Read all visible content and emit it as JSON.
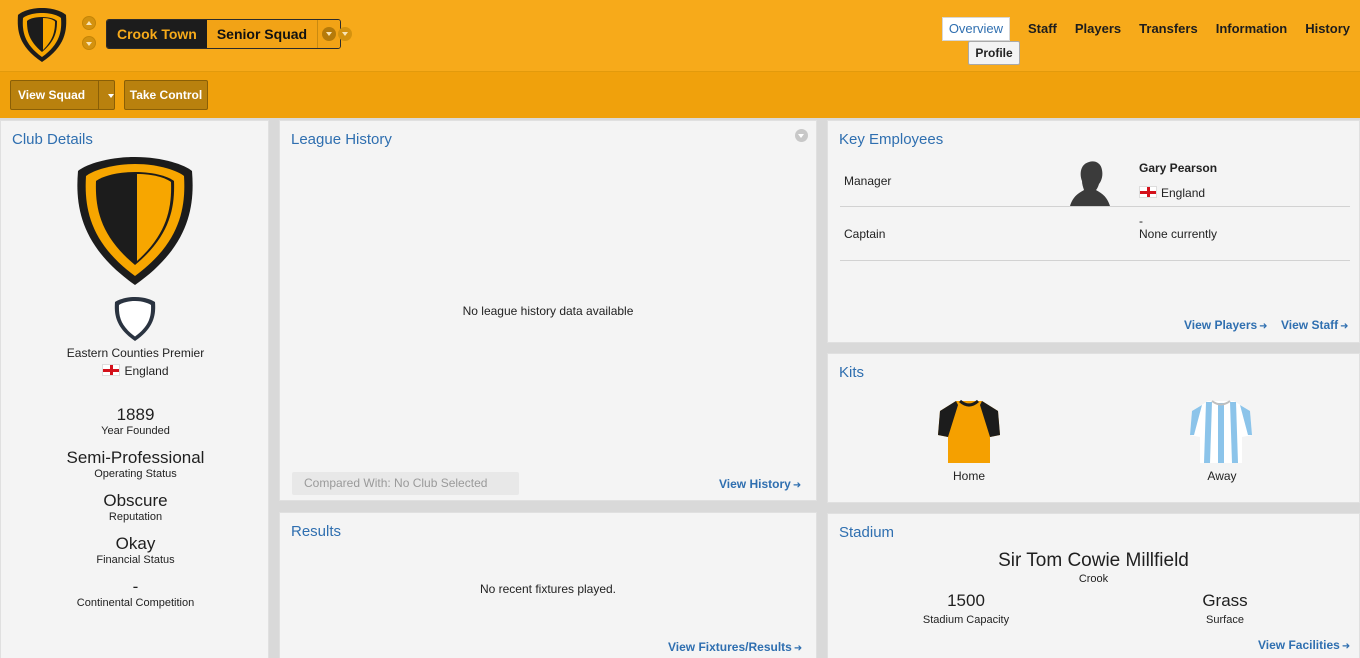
{
  "header": {
    "club_name": "Crook Town",
    "squad_name": "Senior Squad",
    "nav": [
      "Overview",
      "Staff",
      "Players",
      "Transfers",
      "Information",
      "History"
    ],
    "subnav": "Profile"
  },
  "toolbar": {
    "view_squad": "View Squad",
    "take_control": "Take Control"
  },
  "club_details": {
    "title": "Club Details",
    "competition": "Eastern Counties Premier",
    "nation": "England",
    "stats": [
      {
        "value": "1889",
        "label": "Year Founded"
      },
      {
        "value": "Semi-Professional",
        "label": "Operating Status"
      },
      {
        "value": "Obscure",
        "label": "Reputation"
      },
      {
        "value": "Okay",
        "label": "Financial Status"
      },
      {
        "value": "-",
        "label": "Continental Competition"
      }
    ]
  },
  "league_history": {
    "title": "League History",
    "empty_message": "No league history data available",
    "compare_label": "Compared With: No Club Selected",
    "link": "View History"
  },
  "results": {
    "title": "Results",
    "empty_message": "No recent fixtures played.",
    "link": "View Fixtures/Results"
  },
  "key_employees": {
    "title": "Key Employees",
    "rows": [
      {
        "role": "Manager",
        "name": "Gary Pearson",
        "nation": "England"
      },
      {
        "role": "Captain",
        "name": "-",
        "status": "None currently"
      }
    ],
    "link_players": "View Players",
    "link_staff": "View Staff"
  },
  "kits": {
    "title": "Kits",
    "items": [
      {
        "label": "Home"
      },
      {
        "label": "Away"
      }
    ]
  },
  "stadium": {
    "title": "Stadium",
    "name": "Sir Tom Cowie Millfield",
    "city": "Crook",
    "capacity": "1500",
    "capacity_label": "Stadium Capacity",
    "surface": "Grass",
    "surface_label": "Surface",
    "link": "View Facilities"
  },
  "colors": {
    "accent": "#f7aa1a",
    "link": "#2f6fb0",
    "club_primary": "#f7a600",
    "club_secondary": "#1c1c1c"
  }
}
